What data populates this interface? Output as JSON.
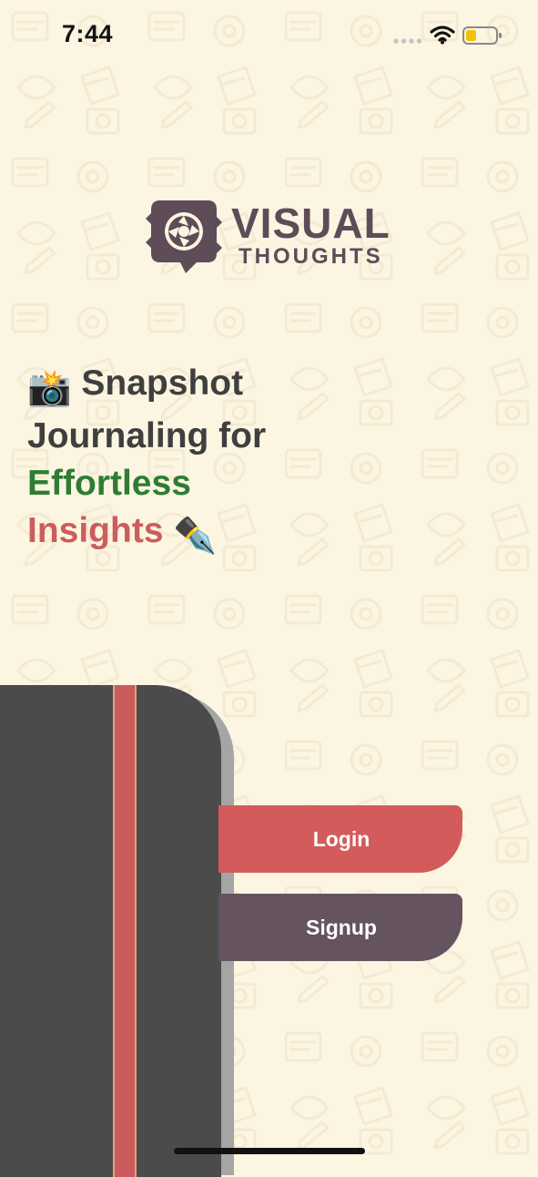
{
  "status_bar": {
    "time": "7:44"
  },
  "logo": {
    "word1": "VISUAL",
    "word2": "THOUGHTS",
    "color": "#5e4c58"
  },
  "headline": {
    "line1_emoji": "📸",
    "line1": "Snapshot",
    "line2": "Journaling for",
    "line3": "Effortless",
    "line4": "Insights",
    "line4_emoji": "✒️"
  },
  "buttons": {
    "login": "Login",
    "signup": "Signup"
  },
  "colors": {
    "background": "#fcf5e2",
    "accent_green": "#2e7d32",
    "accent_red": "#cc5d5d",
    "login_button": "#d35b5b",
    "signup_button": "#65535f",
    "notebook": "#4b4b4b"
  }
}
